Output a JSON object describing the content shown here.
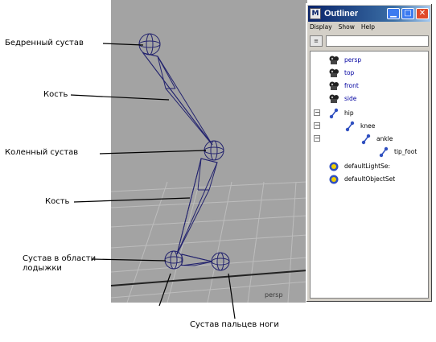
{
  "viewport": {
    "camera_label": "persp"
  },
  "annotations": {
    "hip_joint": "Бедренный сустав",
    "bone_upper": "Кость",
    "knee_joint": "Коленный сустав",
    "bone_lower": "Кость",
    "ankle_joint_line1": "Сустав в области",
    "ankle_joint_line2": "лодыжки",
    "toe_joint": "Сустав пальцев ноги"
  },
  "outliner": {
    "title": "Outliner",
    "app_icon_letter": "M",
    "menu": [
      "Display",
      "Show",
      "Help"
    ],
    "filter_button": "≡",
    "filter_value": "",
    "items": [
      {
        "label": "persp",
        "icon": "camera-icon",
        "expander": ""
      },
      {
        "label": "top",
        "icon": "camera-icon",
        "expander": ""
      },
      {
        "label": "front",
        "icon": "camera-icon",
        "expander": ""
      },
      {
        "label": "side",
        "icon": "camera-icon",
        "expander": ""
      },
      {
        "label": "hip",
        "icon": "joint-icon",
        "expander": "−"
      },
      {
        "label": "knee",
        "icon": "joint-icon",
        "expander": "−"
      },
      {
        "label": "ankle",
        "icon": "joint-icon",
        "expander": "−"
      },
      {
        "label": "tip_foot",
        "icon": "joint-icon",
        "expander": ""
      },
      {
        "label": "defaultLightSe:",
        "icon": "set-icon",
        "expander": ""
      },
      {
        "label": "defaultObjectSet",
        "icon": "set-icon",
        "expander": ""
      }
    ]
  },
  "colors": {
    "viewport_bg": "#a3a3a3",
    "skeleton": "#2a2a7a",
    "title_bar": "#0a246a",
    "label_text": "#0000a0"
  }
}
